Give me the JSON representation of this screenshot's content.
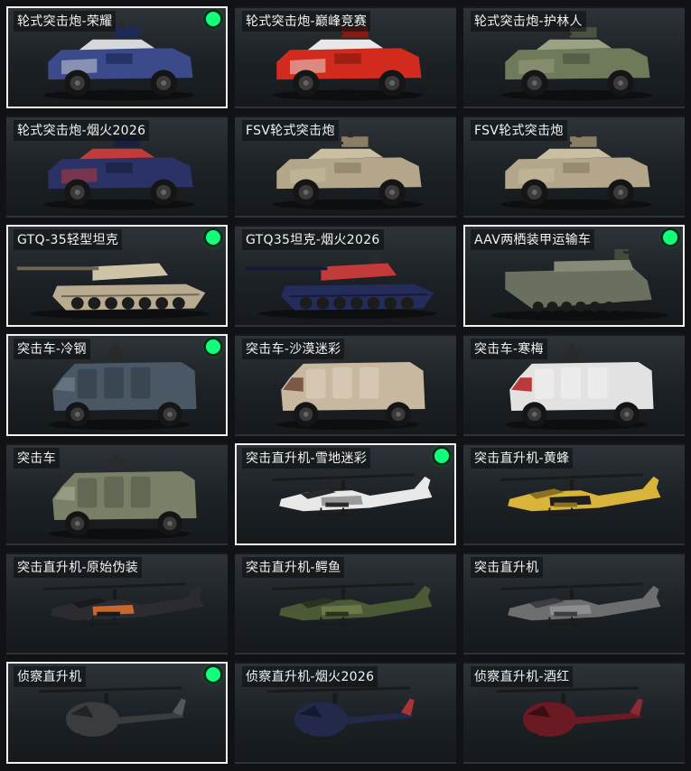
{
  "items": [
    {
      "label": "轮式突击炮-荣耀",
      "kind": "armored-car",
      "colors": [
        "#3a4a8a",
        "#d6d8dc",
        "#1d2a55"
      ],
      "selected": true,
      "equipped": true
    },
    {
      "label": "轮式突击炮-巅峰竞赛",
      "kind": "armored-car",
      "colors": [
        "#d22a1c",
        "#e8e8e8",
        "#8a1a10"
      ],
      "selected": false,
      "equipped": false
    },
    {
      "label": "轮式突击炮-护林人",
      "kind": "armored-car",
      "colors": [
        "#6f7a5a",
        "#9aa184",
        "#4a5240"
      ],
      "selected": false,
      "equipped": false
    },
    {
      "label": "轮式突击炮-烟火2026",
      "kind": "armored-car",
      "colors": [
        "#2a3266",
        "#c23a3a",
        "#1a1f3f"
      ],
      "selected": false,
      "equipped": false
    },
    {
      "label": "FSV轮式突击炮",
      "kind": "armored-car",
      "colors": [
        "#b3a68a",
        "#cbbfa2",
        "#8a7f66"
      ],
      "selected": false,
      "equipped": false
    },
    {
      "label": "FSV轮式突击炮",
      "kind": "armored-car",
      "colors": [
        "#b3a68a",
        "#cbbfa2",
        "#8a7f66"
      ],
      "selected": false,
      "equipped": false
    },
    {
      "label": "GTQ-35轻型坦克",
      "kind": "tank",
      "colors": [
        "#b8ab90",
        "#d0c4a8",
        "#6e6655"
      ],
      "selected": true,
      "equipped": true
    },
    {
      "label": "GTQ35坦克-烟火2026",
      "kind": "tank",
      "colors": [
        "#232c5a",
        "#c23a3a",
        "#161a33"
      ],
      "selected": false,
      "equipped": false
    },
    {
      "label": "AAV两栖装甲运输车",
      "kind": "amphibious",
      "colors": [
        "#6a7060",
        "#858b78",
        "#454a3e"
      ],
      "selected": true,
      "equipped": true
    },
    {
      "label": "突击车-冷钢",
      "kind": "assault-vehicle",
      "colors": [
        "#4a5866",
        "#66727e",
        "#2e3842"
      ],
      "selected": true,
      "equipped": true
    },
    {
      "label": "突击车-沙漠迷彩",
      "kind": "assault-vehicle",
      "colors": [
        "#c9b8a0",
        "#7a5a46",
        "#e0d4c2"
      ],
      "selected": false,
      "equipped": false
    },
    {
      "label": "突击车-寒梅",
      "kind": "assault-vehicle",
      "colors": [
        "#e2e2e2",
        "#b83a3a",
        "#f4f4f4"
      ],
      "selected": false,
      "equipped": false
    },
    {
      "label": "突击车",
      "kind": "assault-vehicle",
      "colors": [
        "#7a8068",
        "#969c82",
        "#4e5344"
      ],
      "selected": false,
      "equipped": false
    },
    {
      "label": "突击直升机-雪地迷彩",
      "kind": "attack-helicopter",
      "colors": [
        "#e8e8e8",
        "#9a9a9a",
        "#2a2a2a"
      ],
      "selected": true,
      "equipped": true
    },
    {
      "label": "突击直升机-黄蜂",
      "kind": "attack-helicopter",
      "colors": [
        "#d8b43a",
        "#1e1e1e",
        "#8a7020"
      ],
      "selected": false,
      "equipped": false
    },
    {
      "label": "突击直升机-原始伪装",
      "kind": "attack-helicopter",
      "colors": [
        "#2c2c30",
        "#c8682a",
        "#1a1a1c"
      ],
      "selected": false,
      "equipped": false
    },
    {
      "label": "突击直升机-鳄鱼",
      "kind": "attack-helicopter",
      "colors": [
        "#4a5a34",
        "#6a7a48",
        "#2a3220"
      ],
      "selected": false,
      "equipped": false
    },
    {
      "label": "突击直升机",
      "kind": "attack-helicopter",
      "colors": [
        "#6c6e70",
        "#8c8e90",
        "#3c3e40"
      ],
      "selected": false,
      "equipped": false
    },
    {
      "label": "侦察直升机",
      "kind": "scout-helicopter",
      "colors": [
        "#3a3c3e",
        "#55585a",
        "#202224"
      ],
      "selected": true,
      "equipped": true
    },
    {
      "label": "侦察直升机-烟火2026",
      "kind": "scout-helicopter",
      "colors": [
        "#22294a",
        "#a83434",
        "#141830"
      ],
      "selected": false,
      "equipped": false
    },
    {
      "label": "侦察直升机-酒红",
      "kind": "scout-helicopter",
      "colors": [
        "#6a1a22",
        "#8a2a32",
        "#3a0e12"
      ],
      "selected": false,
      "equipped": false
    }
  ]
}
